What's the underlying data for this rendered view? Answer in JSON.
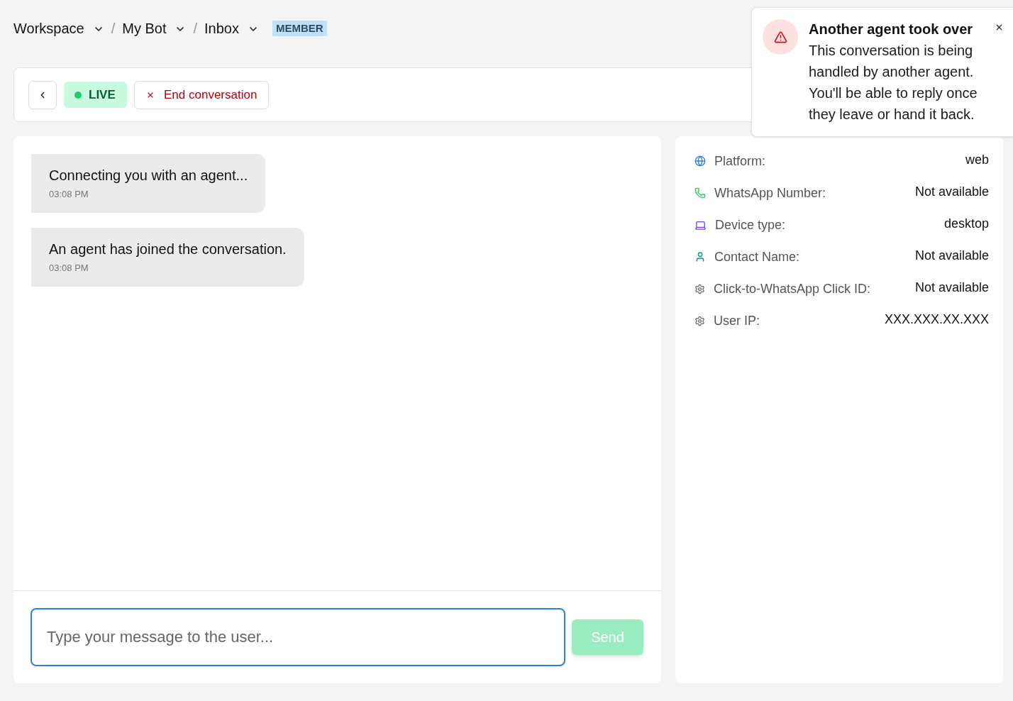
{
  "breadcrumb": [
    {
      "label": "Workspace"
    },
    {
      "separator": "/",
      "label": "My Bot"
    },
    {
      "separator": "/",
      "label": "Inbox"
    }
  ],
  "role_badge": "MEMBER",
  "toolbar": {
    "status_badge": {
      "label": "LIVE",
      "live": true
    },
    "end_button": {
      "label": "End conversation"
    }
  },
  "messages": [
    {
      "text": "Connecting you with an agent...",
      "time": "03:08 PM"
    },
    {
      "text": "An agent has joined the conversation.",
      "time": "03:08 PM"
    }
  ],
  "composer": {
    "placeholder": "Type your message to the user...",
    "focused": true
  },
  "send_button": {
    "label": "Send",
    "disabled": true
  },
  "details": [
    {
      "kind": "globe",
      "label": "Platform:",
      "value": "web"
    },
    {
      "kind": "phone",
      "label": "WhatsApp Number:",
      "value": "Not available"
    },
    {
      "kind": "laptop",
      "label": "Device type:",
      "value": "desktop"
    },
    {
      "kind": "user",
      "label": "Contact Name:",
      "value": "Not available"
    },
    {
      "kind": "gear",
      "label": "Click-to-WhatsApp Click ID:",
      "value": "Not available"
    },
    {
      "kind": "gear",
      "label": "User IP:",
      "value": "XXX.XXX.XX.XXX"
    }
  ],
  "toast": {
    "title": "Another agent took over",
    "message": "This conversation is being handled by another agent. You'll be able to reply once they leave or hand it back."
  }
}
